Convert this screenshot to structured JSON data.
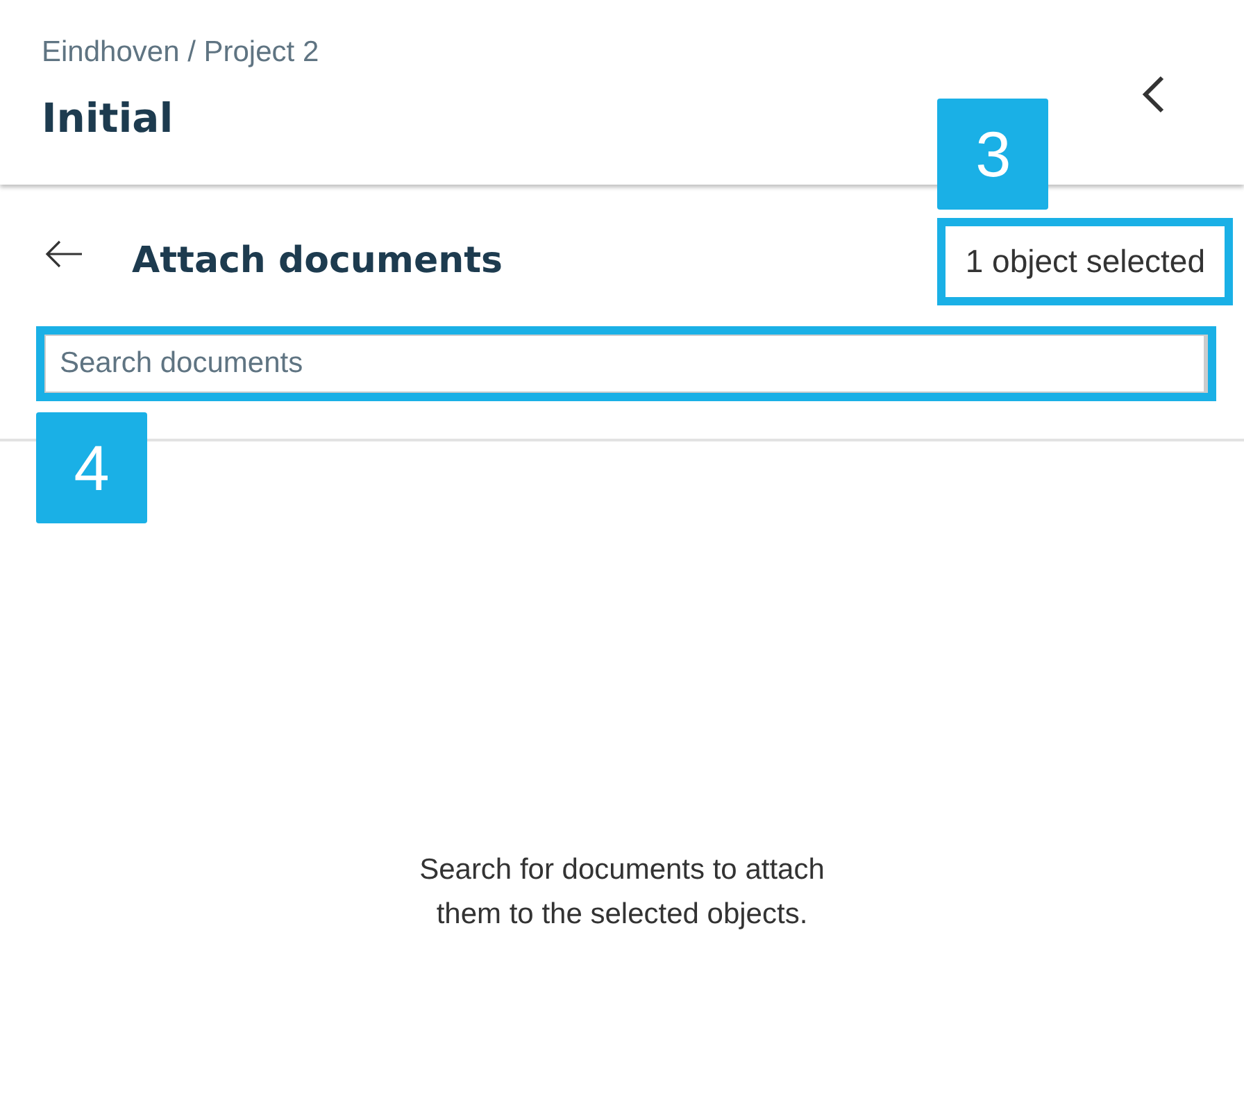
{
  "header": {
    "breadcrumb": "Eindhoven / Project 2",
    "title": "Initial"
  },
  "panel": {
    "heading": "Attach documents",
    "selection_count": "1 object selected",
    "search": {
      "placeholder": "Search documents"
    },
    "empty_message": "Search for documents to attach them to the selected objects."
  },
  "callouts": {
    "selection_count": "3",
    "search": "4"
  }
}
